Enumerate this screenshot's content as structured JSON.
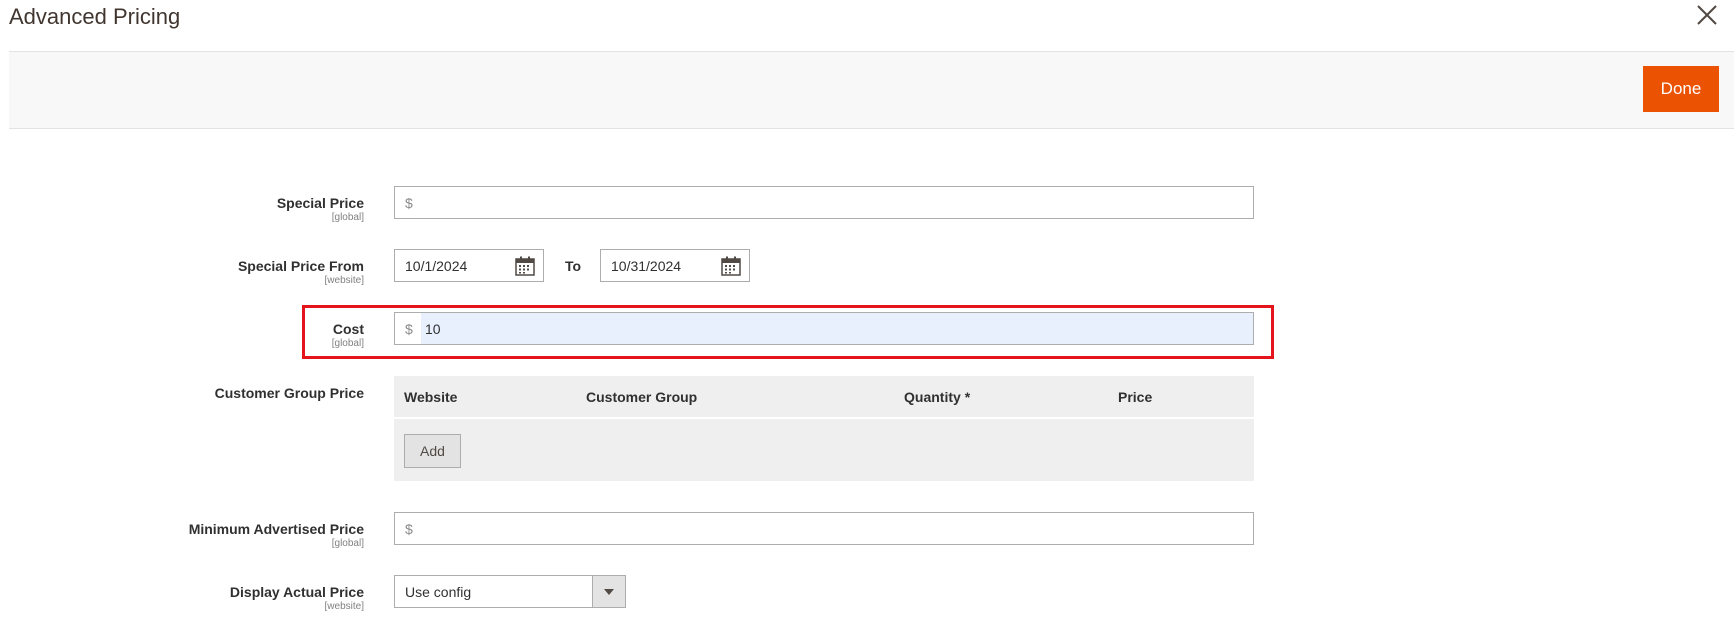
{
  "modal": {
    "title": "Advanced Pricing",
    "done_label": "Done"
  },
  "fields": {
    "special_price": {
      "label": "Special Price",
      "scope": "[global]",
      "currency": "$",
      "value": ""
    },
    "special_price_from": {
      "label": "Special Price From",
      "scope": "[website]",
      "from_value": "10/1/2024",
      "to_label": "To",
      "to_value": "10/31/2024"
    },
    "cost": {
      "label": "Cost",
      "scope": "[global]",
      "currency": "$",
      "value": "10"
    },
    "customer_group_price": {
      "label": "Customer Group Price",
      "columns": [
        "Website",
        "Customer Group",
        "Quantity",
        "Price"
      ],
      "required_mark": "*",
      "add_label": "Add"
    },
    "map": {
      "label": "Minimum Advertised Price",
      "scope": "[global]",
      "currency": "$",
      "value": ""
    },
    "display_actual_price": {
      "label": "Display Actual Price",
      "scope": "[website]",
      "selected": "Use config"
    }
  },
  "colors": {
    "primary_button": "#eb5202",
    "highlight_border": "#e5131b",
    "autofill_bg": "#e8f0fe"
  }
}
